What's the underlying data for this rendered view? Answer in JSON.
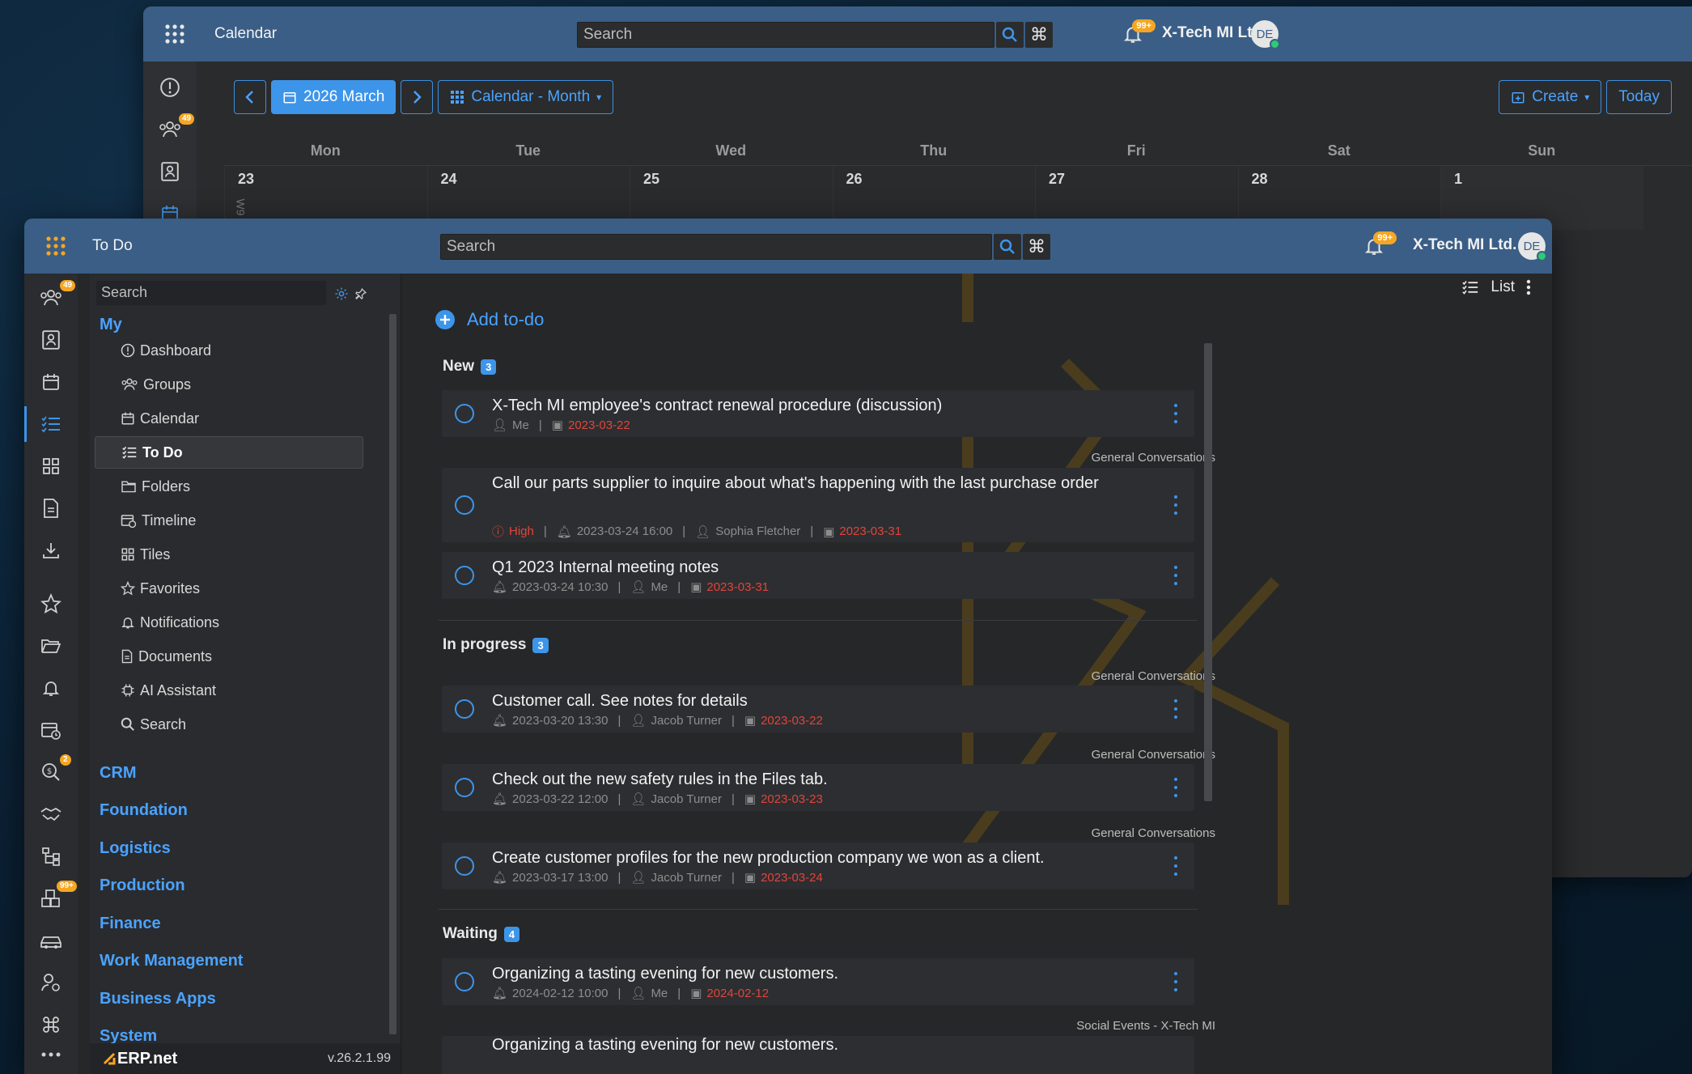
{
  "back_window": {
    "title": "Calendar",
    "search_placeholder": "Search",
    "notification_badge": "99+",
    "company": "X-Tech MI Ltd.",
    "avatar_initials": "DE",
    "rail_badge_groups": "49",
    "toolbar": {
      "period": "2026 March",
      "view": "Calendar - Month",
      "create": "Create",
      "today": "Today"
    },
    "weekdays": [
      "Mon",
      "Tue",
      "Wed",
      "Thu",
      "Fri",
      "Sat",
      "Sun"
    ],
    "dates": [
      "23",
      "24",
      "25",
      "26",
      "27",
      "28",
      "1"
    ],
    "week_label": "W9"
  },
  "front_window": {
    "title": "To Do",
    "search_placeholder": "Search",
    "notification_badge": "99+",
    "company": "X-Tech MI Ltd.",
    "avatar_initials": "DE",
    "rail_badges": {
      "groups": "49",
      "deals": "2",
      "inventory": "99+"
    },
    "nav": {
      "search_placeholder": "Search",
      "my_label": "My",
      "items": [
        {
          "label": "Dashboard",
          "icon": "info-icon"
        },
        {
          "label": "Groups",
          "icon": "groups-icon"
        },
        {
          "label": "Calendar",
          "icon": "calendar-icon"
        },
        {
          "label": "To Do",
          "icon": "todo-list-icon"
        },
        {
          "label": "Folders",
          "icon": "folder-icon"
        },
        {
          "label": "Timeline",
          "icon": "timeline-icon"
        },
        {
          "label": "Tiles",
          "icon": "tiles-icon"
        },
        {
          "label": "Favorites",
          "icon": "star-icon"
        },
        {
          "label": "Notifications",
          "icon": "bell-icon"
        },
        {
          "label": "Documents",
          "icon": "document-icon"
        },
        {
          "label": "AI Assistant",
          "icon": "ai-chip-icon"
        },
        {
          "label": "Search",
          "icon": "search-icon"
        }
      ],
      "groups": [
        "CRM",
        "Foundation",
        "Logistics",
        "Production",
        "Finance",
        "Work Management",
        "Business Apps",
        "System"
      ],
      "logo_text": "ERP.net",
      "version": "v.26.2.1.99"
    },
    "content": {
      "add_todo": "Add to-do",
      "view_mode": "List",
      "sections": [
        {
          "name": "New",
          "count": "3",
          "tasks": [
            {
              "title": "X-Tech MI employee's contract renewal procedure (discussion)",
              "priority": "",
              "reminder": "",
              "assignee": "Me",
              "due": "2023-03-22",
              "folder": "General Conversations"
            },
            {
              "title": "Call our parts supplier to inquire about what's happening with the last purchase order",
              "priority": "High",
              "reminder": "2023-03-24 16:00",
              "assignee": "Sophia Fletcher",
              "due": "2023-03-31",
              "folder": ""
            },
            {
              "title": "Q1 2023 Internal meeting notes",
              "priority": "",
              "reminder": "2023-03-24 10:30",
              "assignee": "Me",
              "due": "2023-03-31",
              "folder": ""
            }
          ]
        },
        {
          "name": "In progress",
          "count": "3",
          "tasks": [
            {
              "title": "Customer call. See notes for details",
              "priority": "",
              "reminder": "2023-03-20 13:30",
              "assignee": "Jacob Turner",
              "due": "2023-03-22",
              "folder_above": "General Conversations"
            },
            {
              "title": "Check out the new safety rules in the Files tab.",
              "priority": "",
              "reminder": "2023-03-22 12:00",
              "assignee": "Jacob Turner",
              "due": "2023-03-23",
              "folder_above": "General Conversations"
            },
            {
              "title": "Create customer profiles for the new production company we won as a client.",
              "priority": "",
              "reminder": "2023-03-17 13:00",
              "assignee": "Jacob Turner",
              "due": "2023-03-24",
              "folder_above": "General Conversations"
            }
          ]
        },
        {
          "name": "Waiting",
          "count": "4",
          "tasks": [
            {
              "title": "Organizing a tasting evening for new customers.",
              "priority": "",
              "reminder": "2024-02-12 10:00",
              "assignee": "Me",
              "due": "2024-02-12",
              "folder": "Social Events - X-Tech MI"
            },
            {
              "title": "Organizing a tasting evening for new customers.",
              "priority": "",
              "reminder": "",
              "assignee": "",
              "due": "",
              "folder": ""
            }
          ]
        }
      ]
    }
  },
  "colors": {
    "titlebar": "#3a5e86",
    "accent": "#3d95ea",
    "badge": "#f5a623",
    "due_red": "#e0453b"
  }
}
